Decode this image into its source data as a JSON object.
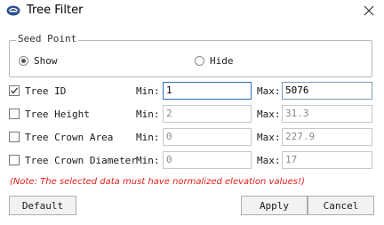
{
  "window": {
    "title": "Tree Filter",
    "logo": "app-logo-icon",
    "close_icon": "close-icon"
  },
  "seed_point": {
    "legend": "Seed Point",
    "options": [
      {
        "label": "Show",
        "selected": true
      },
      {
        "label": "Hide",
        "selected": false
      }
    ]
  },
  "labels": {
    "min": "Min:",
    "max": "Max:"
  },
  "filters": [
    {
      "label": "Tree ID",
      "checked": true,
      "min": "1",
      "max": "5076"
    },
    {
      "label": "Tree Height",
      "checked": false,
      "min": "2",
      "max": "31.3"
    },
    {
      "label": "Tree Crown Area",
      "checked": false,
      "min": "0",
      "max": "227.9"
    },
    {
      "label": "Tree Crown Diameter",
      "checked": false,
      "min": "0",
      "max": "17"
    }
  ],
  "note": "(Note: The selected data must have normalized elevation values!)",
  "buttons": {
    "default": "Default",
    "apply": "Apply",
    "cancel": "Cancel"
  },
  "colors": {
    "note": "#e0201c",
    "focus_border": "#2f6fb8"
  }
}
